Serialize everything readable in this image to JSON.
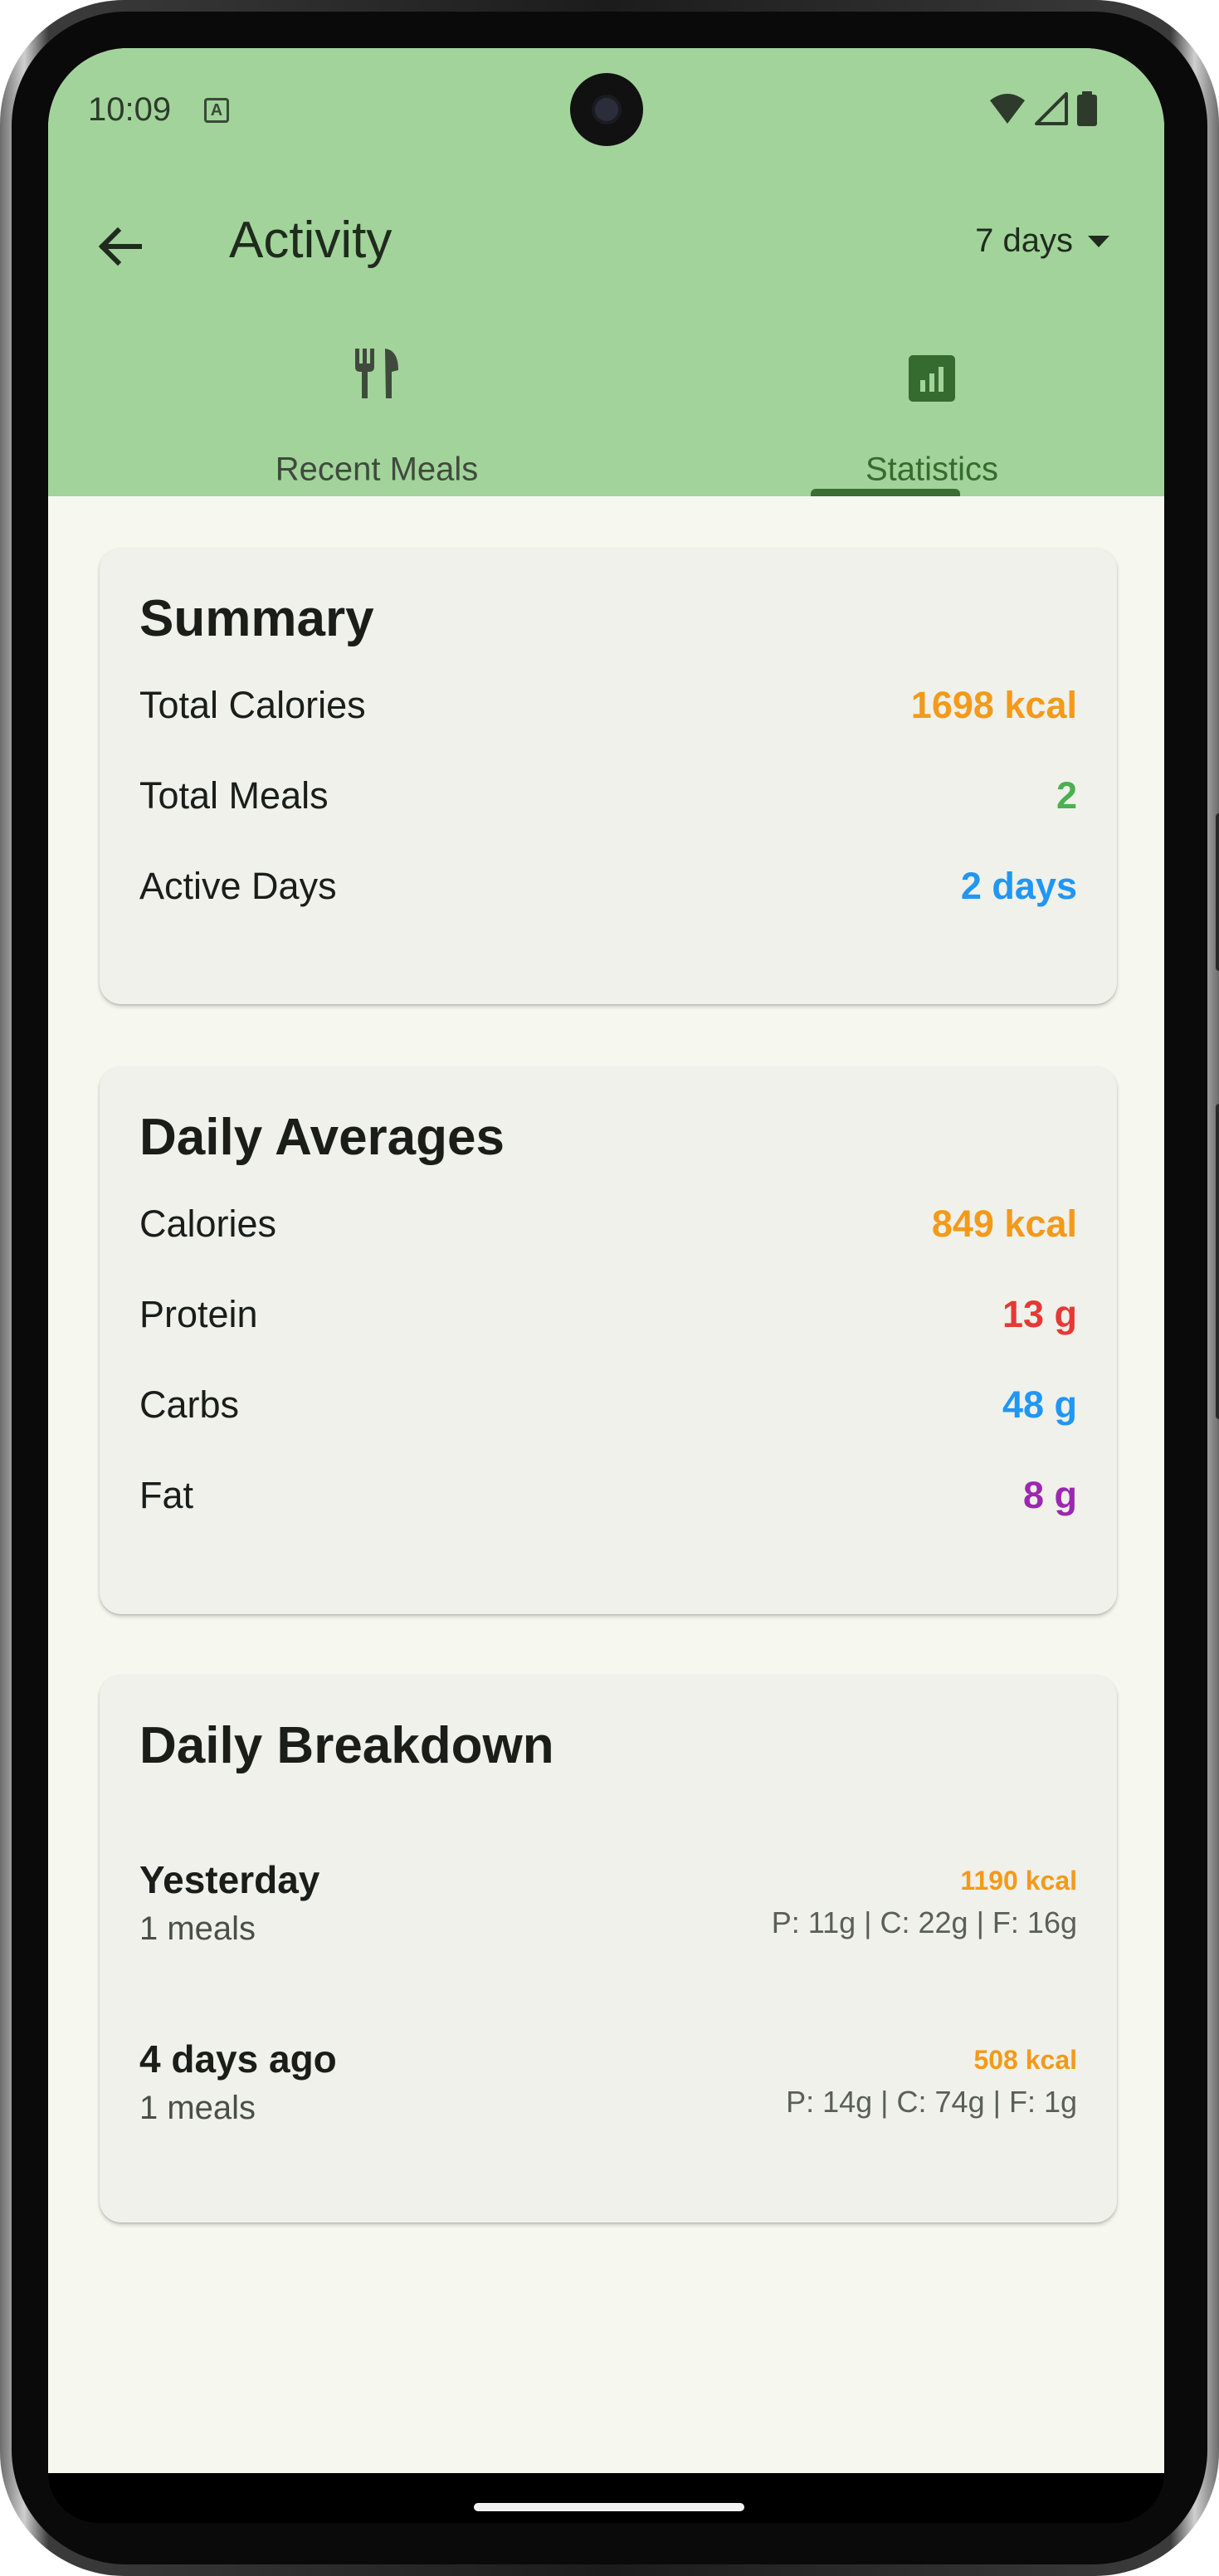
{
  "status_bar": {
    "time": "10:09",
    "a_badge": "A"
  },
  "app_bar": {
    "title": "Activity",
    "period_label": "7 days"
  },
  "tabs": [
    {
      "label": "Recent Meals",
      "icon": "fork-knife-icon",
      "selected": false
    },
    {
      "label": "Statistics",
      "icon": "bar-chart-icon",
      "selected": true
    }
  ],
  "summary": {
    "title": "Summary",
    "rows": [
      {
        "label": "Total Calories",
        "value": "1698 kcal",
        "color": "#f39a1a"
      },
      {
        "label": "Total Meals",
        "value": "2",
        "color": "#4caf50"
      },
      {
        "label": "Active Days",
        "value": "2 days",
        "color": "#2196f3"
      }
    ]
  },
  "averages": {
    "title": "Daily Averages",
    "rows": [
      {
        "label": "Calories",
        "value": "849 kcal",
        "color": "#f39a1a"
      },
      {
        "label": "Protein",
        "value": "13 g",
        "color": "#e53935"
      },
      {
        "label": "Carbs",
        "value": "48 g",
        "color": "#2196f3"
      },
      {
        "label": "Fat",
        "value": "8 g",
        "color": "#9c27b0"
      }
    ]
  },
  "breakdown": {
    "title": "Daily Breakdown",
    "days": [
      {
        "name": "Yesterday",
        "meals": "1 meals",
        "kcal": "1190 kcal",
        "macros": "P: 11g | C: 22g | F: 16g"
      },
      {
        "name": "4 days ago",
        "meals": "1 meals",
        "kcal": "508 kcal",
        "macros": "P: 14g | C: 74g | F: 1g"
      }
    ]
  },
  "colors": {
    "header_bg": "#a2d39b",
    "screen_bg": "#f6f8f0",
    "card_bg": "#eff1ea",
    "tab_indicator": "#3a6e33"
  }
}
